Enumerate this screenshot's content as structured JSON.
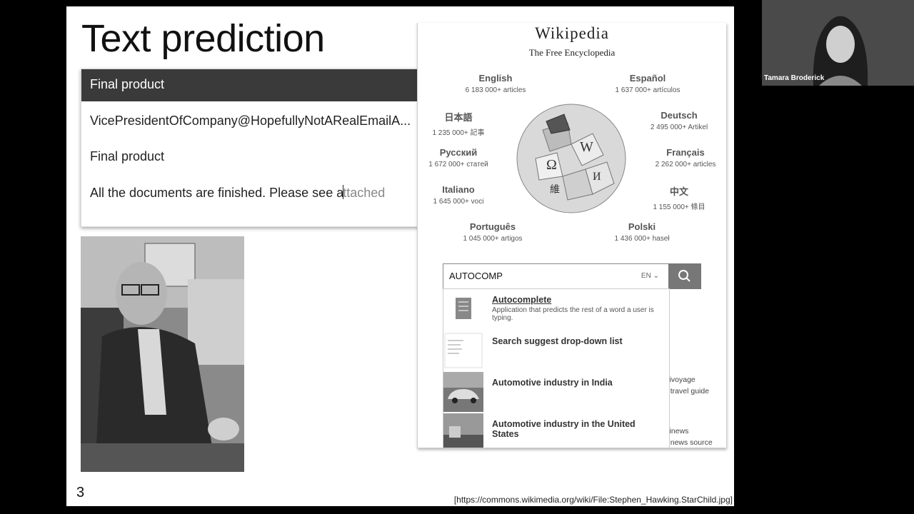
{
  "slide": {
    "title": "Text prediction",
    "slide_number": "3",
    "citation": "[https://commons.wikimedia.org/wiki/File:Stephen_Hawking.StarChild.jpg]"
  },
  "email": {
    "header": "Final product",
    "to": "VicePresidentOfCompany@HopefullyNotARealEmailA...",
    "subject": "Final product",
    "body_typed": "All the documents are finished. Please see a",
    "body_predicted": "ttached"
  },
  "wikipedia": {
    "wordmark": "Wikipedia",
    "tagline": "The Free Encyclopedia",
    "languages": [
      {
        "name": "English",
        "count": "6 183 000+ articles"
      },
      {
        "name": "Español",
        "count": "1 637 000+ artículos"
      },
      {
        "name": "日本語",
        "count": "1 235 000+ 記事"
      },
      {
        "name": "Deutsch",
        "count": "2 495 000+ Artikel"
      },
      {
        "name": "Русский",
        "count": "1 672 000+ статей"
      },
      {
        "name": "Français",
        "count": "2 262 000+ articles"
      },
      {
        "name": "Italiano",
        "count": "1 645 000+ voci"
      },
      {
        "name": "中文",
        "count": "1 155 000+ 條目"
      },
      {
        "name": "Português",
        "count": "1 045 000+ artigos"
      },
      {
        "name": "Polski",
        "count": "1 436 000+ haseł"
      }
    ],
    "search": {
      "value": "AUTOCOMP",
      "lang": "EN"
    },
    "suggestions": [
      {
        "title": "Autocomplete",
        "desc": "Application that predicts the rest of a word a user is typing."
      },
      {
        "title": "Search suggest drop-down list",
        "desc": ""
      },
      {
        "title": "Automotive industry in India",
        "desc": ""
      },
      {
        "title": "Automotive industry in the United States",
        "desc": ""
      }
    ],
    "side_links": [
      {
        "text": "ikivoyage"
      },
      {
        "text": "e travel guide"
      },
      {
        "text": "ikinews"
      },
      {
        "text": "e news source"
      }
    ]
  },
  "webcam": {
    "name": "Tamara Broderick"
  },
  "icons": [
    "search-icon",
    "chevron-down-icon",
    "wikipedia-globe-logo"
  ]
}
